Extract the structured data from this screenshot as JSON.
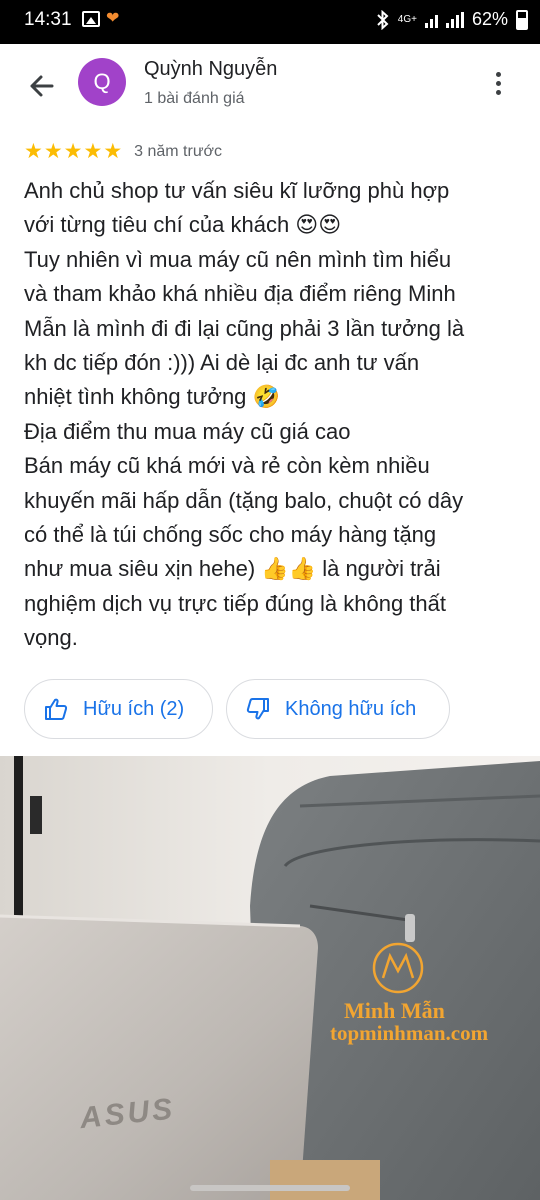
{
  "status_bar": {
    "time": "14:31",
    "network": "4G+",
    "battery": "62%",
    "icons": [
      "gallery-icon",
      "app-heart-icon",
      "bluetooth-icon",
      "signal-icon",
      "battery-icon"
    ]
  },
  "header": {
    "back_icon": "arrow-back-icon",
    "avatar_letter": "Q",
    "avatar_color": "#a142c9",
    "reviewer_name": "Quỳnh Nguyễn",
    "reviewer_subtitle": "1 bài đánh giá",
    "more_icon": "more-vert-icon"
  },
  "review": {
    "stars": 5,
    "star_color": "#fbbc04",
    "time_ago": "3 năm trước",
    "text": "Anh chủ shop tư vấn siêu kĩ lưỡng phù hợp\nvới từng tiêu chí của khách 😍😍\nTuy nhiên vì mua máy cũ nên mình tìm hiểu\nvà tham khảo khá nhiều địa điểm riêng Minh\nMẫn là mình đi đi lại cũng phải 3 lần tưởng là\nkh dc tiếp đón :))) Ai dè lại đc anh tư vấn\nnhiệt tình không tưởng 🤣\nĐịa điểm thu mua máy cũ giá cao\nBán máy cũ khá mới và rẻ còn kèm nhiều\nkhuyến mãi hấp dẫn (tặng balo, chuột có dây\ncó thể là túi chống sốc cho máy hàng tặng\nnhư mua siêu xịn hehe) 👍👍 là người trải\nnghiệm dịch vụ trực tiếp đúng là không thất\nvọng."
  },
  "actions": {
    "helpful_label": "Hữu ích (2)",
    "unhelpful_label": "Không hữu ích",
    "accent_color": "#1a73e8"
  },
  "photo": {
    "brand_name": "Minh Mẫn",
    "brand_url": "topminhman.com",
    "laptop_logo": "ASUS"
  }
}
